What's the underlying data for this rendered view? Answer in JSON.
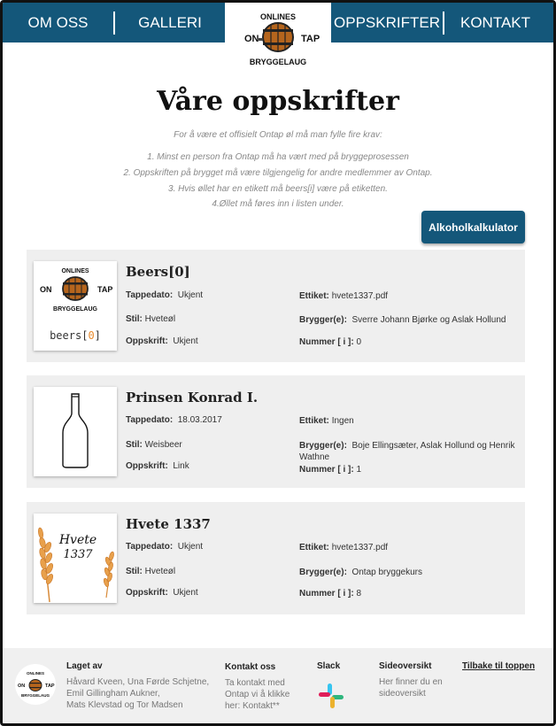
{
  "nav": {
    "items": [
      "OM OSS",
      "GALLERI",
      "OPPSKRIFTER",
      "KONTAKT"
    ],
    "logo": {
      "top": "ONLINES",
      "left": "ON",
      "right": "TAP",
      "bottom": "BRYGGELAUG"
    }
  },
  "header": {
    "title": "Våre oppskrifter",
    "intro": "For å være et offisielt Ontap øl må man fylle fire krav:",
    "rules": [
      "1. Minst en person fra Ontap må ha vært med på bryggeprosessen",
      "2. Oppskriften på brygget må være tilgjengelig for andre medlemmer av Ontap.",
      "3. Hvis øllet har en etikett må beers[i] være på etiketten.",
      "4.Øllet må føres inn i listen under."
    ],
    "calc_button": "Alkoholkalkulator"
  },
  "labels": {
    "tappedato": "Tappedato:",
    "stil": "Stil:",
    "oppskrift": "Oppskrift:",
    "etikett": "Ettiket:",
    "brygger": "Brygger(e):",
    "nummer": "Nummer [ i ]:"
  },
  "beers": [
    {
      "name": "Beers[0]",
      "tappedato": "Ukjent",
      "stil": "Hveteøl",
      "oppskrift": "Ukjent",
      "etikett": "hvete1337.pdf",
      "brygger": "Sverre Johann Bjørke og Aslak Hollund",
      "nummer": "0",
      "image_caption_a": "beers[",
      "image_caption_b": "0",
      "image_caption_c": "]"
    },
    {
      "name": "Prinsen Konrad I.",
      "tappedato": "18.03.2017",
      "stil": "Weisbeer",
      "oppskrift": "Link",
      "etikett": "Ingen",
      "brygger": "Boje Ellingsæter, Aslak Hollund og Henrik Wathne",
      "nummer": "1"
    },
    {
      "name": "Hvete 1337",
      "tappedato": "Ukjent",
      "stil": "Hveteøl",
      "oppskrift": "Ukjent",
      "etikett": "hvete1337.pdf",
      "brygger": "Ontap bryggekurs",
      "nummer": "8",
      "label_line1": "Hvete",
      "label_line2": "1337"
    }
  ],
  "footer": {
    "made_by_heading": "Laget av",
    "made_by": [
      "Håvard Kveen, Una Førde Schjetne,",
      "Emil Gillingham Aukner,",
      "Mats Klevstad og Tor Madsen"
    ],
    "contact_heading": "Kontakt oss",
    "contact": [
      "Ta kontakt med",
      "Ontap vi å klikke",
      "her: Kontakt**"
    ],
    "slack_heading": "Slack",
    "sitemap_heading": "Sideoversikt",
    "sitemap": [
      "Her finner du en",
      "sideoversikt"
    ],
    "back_to_top": "Tilbake til toppen"
  },
  "colors": {
    "nav": "#14577a",
    "card": "#efefef",
    "footer": "#f0f0f0",
    "accent": "#e8892b"
  }
}
